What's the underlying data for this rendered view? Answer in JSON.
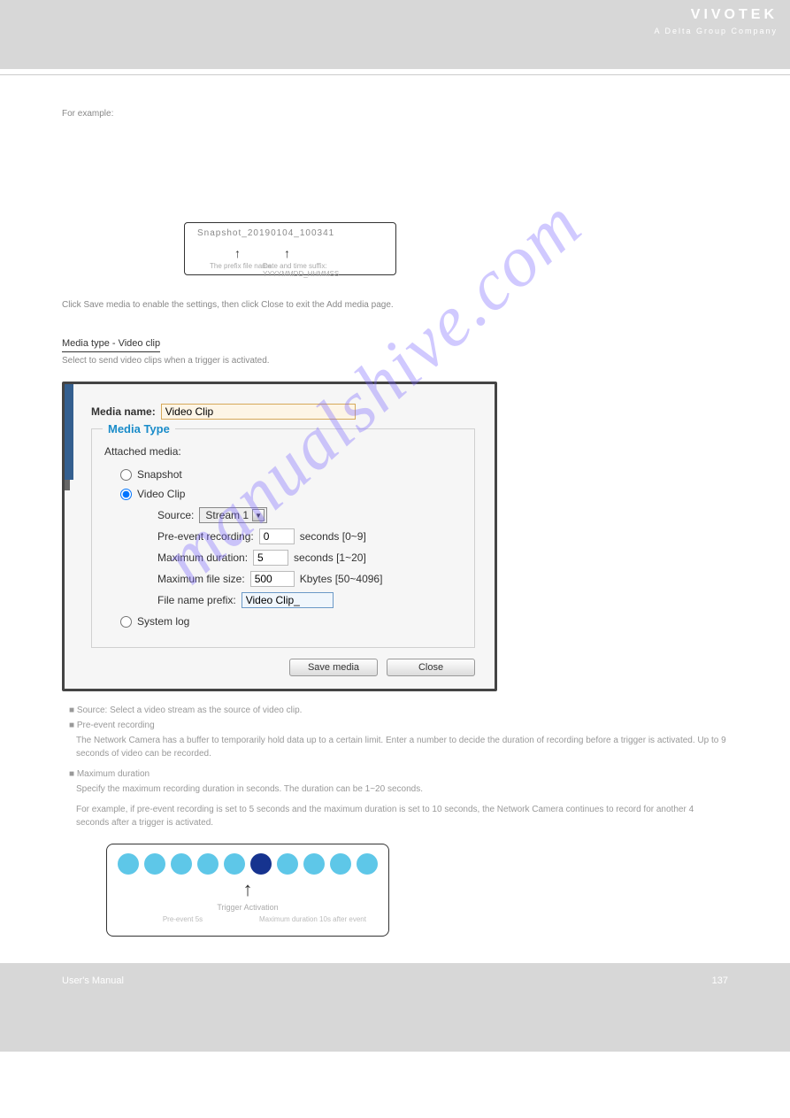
{
  "header": {
    "brand": "VIVOTEK",
    "tagline": "A Delta Group Company"
  },
  "intro_line": "For example:",
  "box1": {
    "filename": "Snapshot_20190104_100341",
    "arrow1_label": "The prefix file name",
    "arrow2_label": "Date and time suffix: YYYYMMDD_HHMMSS"
  },
  "snapshot_desc": "Click Save media to enable the settings, then click Close to exit the Add media page.",
  "media_video": {
    "title": "Media type - Video clip",
    "subtitle": "Select to send video clips when a trigger is activated."
  },
  "dialog": {
    "media_name_label": "Media name:",
    "media_name_value": "Video Clip",
    "fieldset_title": "Media Type",
    "attached_label": "Attached media:",
    "opt_snapshot": "Snapshot",
    "opt_video": "Video Clip",
    "source_label": "Source:",
    "source_value": "Stream 1",
    "pre_label": "Pre-event recording:",
    "pre_value": "0",
    "pre_unit": "seconds [0~9]",
    "maxdur_label": "Maximum duration:",
    "maxdur_value": "5",
    "maxdur_unit": "seconds [1~20]",
    "maxsize_label": "Maximum file size:",
    "maxsize_value": "500",
    "maxsize_unit": "Kbytes [50~4096]",
    "prefix_label": "File name prefix:",
    "prefix_value": "Video Clip_",
    "opt_syslog": "System log",
    "btn_save": "Save media",
    "btn_close": "Close"
  },
  "below": {
    "bul1": "Source: Select a video stream as the source of video clip.",
    "bul2": "Pre-event recording",
    "desc2": "The Network Camera has a buffer to temporarily hold data up to a certain limit. Enter a number to decide the duration of recording before a trigger is activated. Up to 9 seconds of video can be recorded.",
    "bul3": "Maximum duration",
    "desc3": "Specify the maximum recording duration in seconds. The duration can be 1~20 seconds.",
    "ex": "For example, if pre-event recording is set to 5 seconds and the maximum duration is set to 10 seconds, the Network Camera continues to record for another 4 seconds after a trigger is activated."
  },
  "box2": {
    "trigger_label": "Trigger Activation",
    "left_label": "Pre-event 5s",
    "right_label": "Maximum duration 10s after event"
  },
  "footer": {
    "um": "User's Manual",
    "page": "137"
  },
  "watermark": "manualshive.com"
}
